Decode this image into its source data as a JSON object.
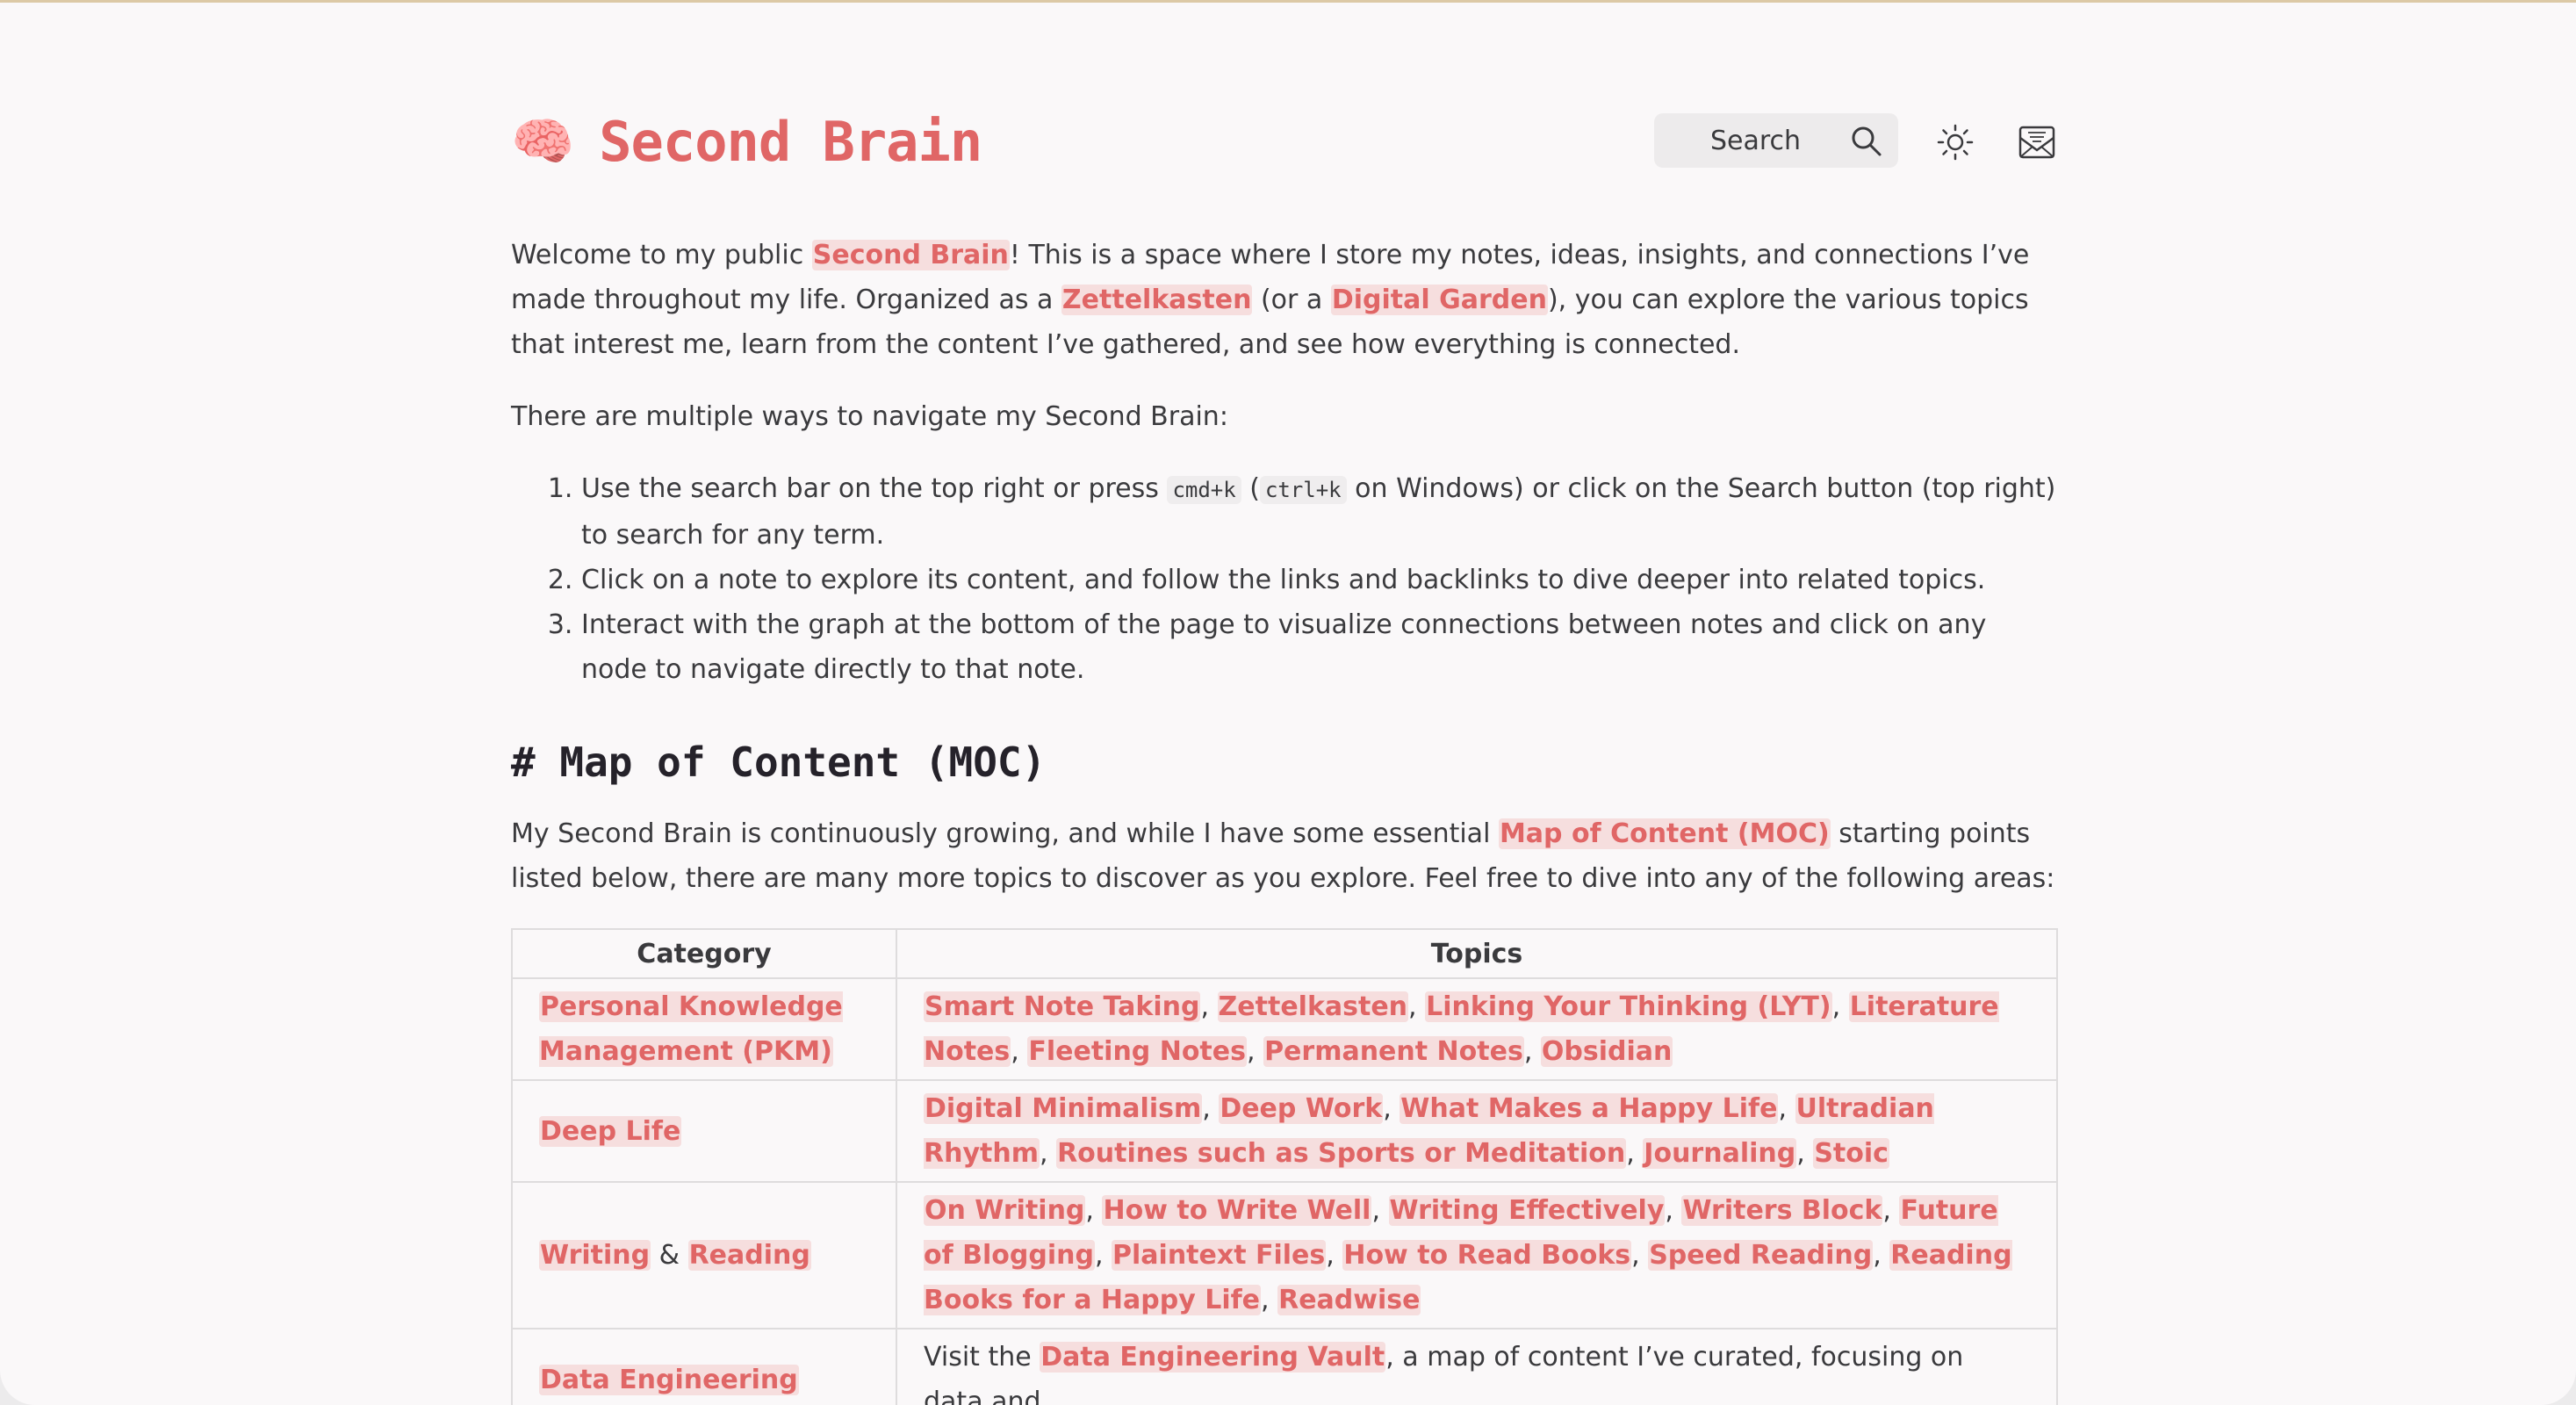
{
  "header": {
    "brain_emoji": "🧠",
    "title": "Second Brain",
    "search_label": "Search"
  },
  "intro": {
    "p1_a": "Welcome to my public ",
    "p1_link1": "Second Brain",
    "p1_b": "! This is a space where I store my notes, ideas, insights, and connections I’ve made throughout my life. Organized as a ",
    "p1_link2": "Zettelkasten",
    "p1_c": " (or a ",
    "p1_link3": "Digital Garden",
    "p1_d": "), you can explore the various topics that interest me, learn from the content I’ve gathered, and see how everything is connected.",
    "p2": "There are multiple ways to navigate my Second Brain:"
  },
  "steps": [
    {
      "a": "Use the search bar on the top right or press ",
      "code1": "cmd+k",
      "b": " (",
      "code2": "ctrl+k",
      "c": " on Windows) or click on the Search button (top right) to search for any term."
    },
    {
      "text": "Click on a note to explore its content, and follow the links and backlinks to dive deeper into related topics."
    },
    {
      "text": "Interact with the graph at the bottom of the page to visualize connections between notes and click on any node to navigate directly to that note."
    }
  ],
  "moc": {
    "heading": "# Map of Content (MOC)",
    "p_a": "My Second Brain is continuously growing, and while I have some essential ",
    "p_link": "Map of Content (MOC)",
    "p_b": " starting points listed below, there are many more topics to discover as you explore. Feel free to dive into any of the following areas:"
  },
  "table": {
    "headers": [
      "Category",
      "Topics"
    ],
    "rows": [
      {
        "category": [
          "Personal Knowledge Management (PKM)"
        ],
        "topics": [
          "Smart Note Taking",
          "Zettelkasten",
          "Linking Your Thinking (LYT)",
          "Literature Notes",
          "Fleeting Notes",
          "Permanent Notes",
          "Obsidian"
        ]
      },
      {
        "category": [
          "Deep Life"
        ],
        "topics": [
          "Digital Minimalism",
          "Deep Work",
          "What Makes a Happy Life",
          "Ultradian Rhythm",
          "Routines such as Sports or Meditation",
          "Journaling",
          "Stoic"
        ]
      },
      {
        "category": [
          "Writing",
          "Reading"
        ],
        "category_sep": " & ",
        "topics": [
          "On Writing",
          "How to Write Well",
          "Writing Effectively",
          "Writers Block",
          "Future of Blogging",
          "Plaintext Files",
          "How to Read Books",
          "Speed Reading",
          "Reading Books for a Happy Life",
          "Readwise"
        ]
      },
      {
        "category": [
          "Data Engineering"
        ],
        "topics_prefix": "Visit the ",
        "topics_link": "Data Engineering Vault",
        "topics_suffix": ", a map of content I’ve curated, focusing on data and"
      }
    ]
  },
  "colors": {
    "accent": "#e06666",
    "link_bg": "#f6dede",
    "page_bg": "#faf8f9",
    "heading": "#25222a"
  }
}
